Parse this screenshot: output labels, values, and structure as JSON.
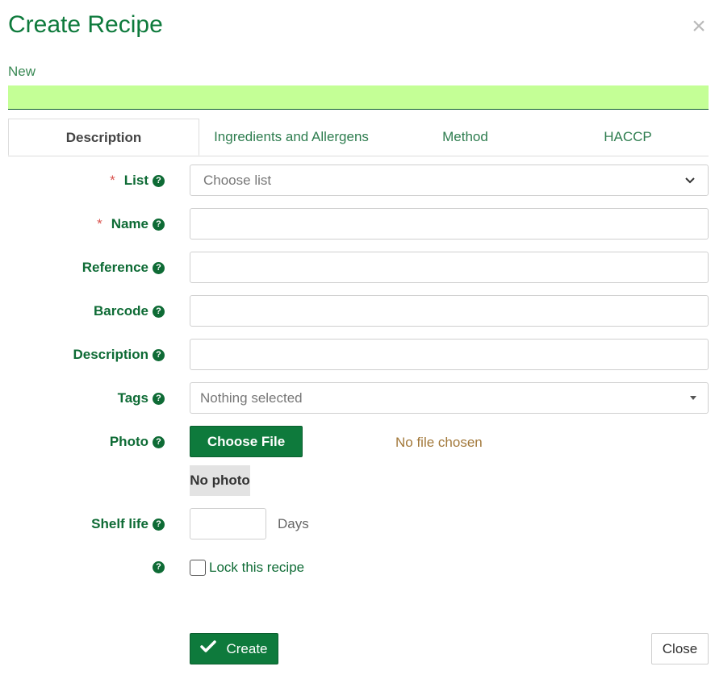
{
  "modal": {
    "title": "Create Recipe",
    "close_symbol": "×",
    "status_label": "New"
  },
  "tabs": [
    {
      "label": "Description",
      "active": true
    },
    {
      "label": "Ingredients and Allergens",
      "active": false
    },
    {
      "label": "Method",
      "active": false
    },
    {
      "label": "HACCP",
      "active": false
    }
  ],
  "form": {
    "list": {
      "label": "List",
      "required": true,
      "placeholder": "Choose list"
    },
    "name": {
      "label": "Name",
      "required": true,
      "value": ""
    },
    "reference": {
      "label": "Reference",
      "value": ""
    },
    "barcode": {
      "label": "Barcode",
      "value": ""
    },
    "description": {
      "label": "Description",
      "value": ""
    },
    "tags": {
      "label": "Tags",
      "placeholder": "Nothing selected"
    },
    "photo": {
      "label": "Photo",
      "button": "Choose File",
      "file_status": "No file chosen",
      "preview": "No photo"
    },
    "shelf_life": {
      "label": "Shelf life",
      "value": "",
      "unit": "Days"
    },
    "lock": {
      "label": "Lock this recipe",
      "checked": false
    }
  },
  "footer": {
    "create_label": "Create",
    "close_label": "Close"
  },
  "colors": {
    "brand_green": "#0e7a3c",
    "status_bar": "#c4ff96",
    "required": "#d9534f"
  },
  "icons": {
    "help": "question-circle-icon",
    "check": "check-icon",
    "dropdown": "chevron-down-icon"
  }
}
